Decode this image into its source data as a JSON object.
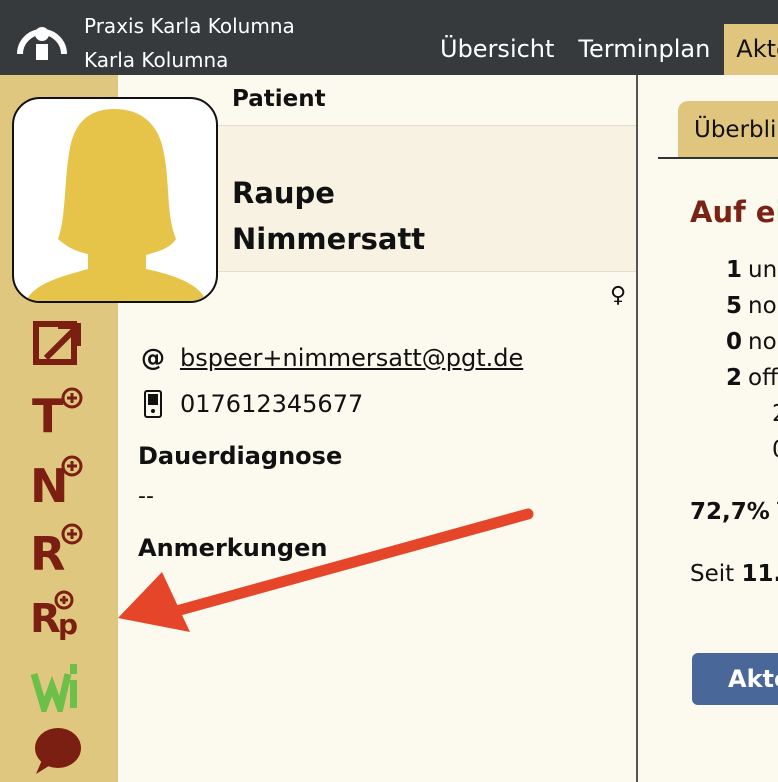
{
  "header": {
    "practice_name": "Praxis Karla Kolumna",
    "user_name": "Karla Kolumna",
    "nav": [
      {
        "label": "Übersicht"
      },
      {
        "label": "Terminplan"
      },
      {
        "label": "Akte"
      }
    ]
  },
  "patient": {
    "section_label": "Patient",
    "first_name": "Raupe",
    "last_name": "Nimmersatt",
    "gender_symbol": "♀",
    "email": "bspeer+nimmersatt@pgt.de",
    "phone": "017612345677",
    "diagnosis_label": "Dauerdiagnose",
    "diagnosis_value": "--",
    "notes_label": "Anmerkungen"
  },
  "toolbar": [
    {
      "icon": "external-link-icon",
      "letter": ""
    },
    {
      "icon": "add-t-icon",
      "letter": "T"
    },
    {
      "icon": "add-n-icon",
      "letter": "N"
    },
    {
      "icon": "add-r-icon",
      "letter": "R"
    },
    {
      "icon": "add-rp-icon",
      "letter": "Rp"
    },
    {
      "icon": "wi-icon",
      "letter": "W"
    },
    {
      "icon": "chat-bubble-icon",
      "letter": ""
    }
  ],
  "right_panel": {
    "tab_label": "Überbli",
    "heading": "Auf ei",
    "stats": [
      {
        "num": "1",
        "text": "un"
      },
      {
        "num": "5",
        "text": "no"
      },
      {
        "num": "0",
        "text": "no"
      },
      {
        "num": "2",
        "text": "off"
      }
    ],
    "sub_values": [
      "2",
      "0"
    ],
    "percent_bold": "72,7%",
    "percent_text": "T",
    "since_prefix": "Seit",
    "since_bold": "11.",
    "button_label": "Akte"
  },
  "colors": {
    "topbar": "#363a3d",
    "accent": "#dfc57d",
    "icon_red": "#7a1f12",
    "icon_green": "#6cc04a",
    "heading_red": "#7a2314",
    "button_blue": "#4a679a",
    "annotation_arrow": "#e5462a",
    "avatar_yellow": "#e6c349"
  }
}
